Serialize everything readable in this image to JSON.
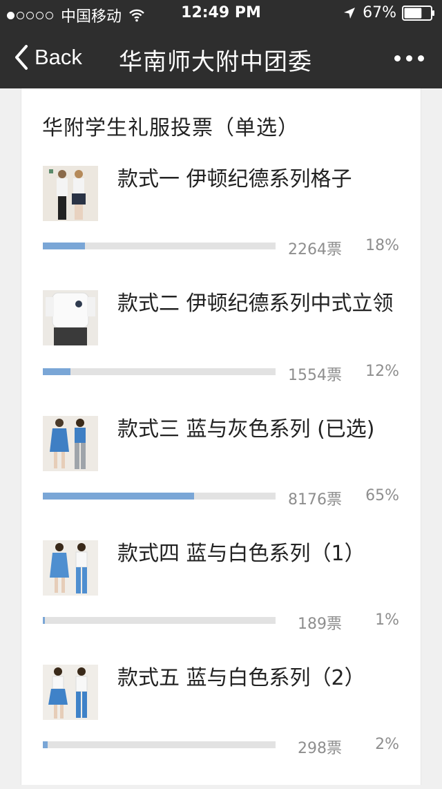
{
  "status_bar": {
    "carrier": "中国移动",
    "time": "12:49 PM",
    "battery": "67%",
    "battery_level": 0.67,
    "signal_bars_filled": 1,
    "signal_bars_total": 5
  },
  "nav": {
    "back_label": "Back",
    "title": "华南师大附中团委"
  },
  "poll": {
    "title": "华附学生礼服投票（单选）",
    "bar_color": "#7aa6d6",
    "options": [
      {
        "label": "款式一 伊顿纪德系列格子",
        "votes": "2264票",
        "percent": "18%",
        "fraction": 0.18,
        "thumb_icon": "uniform-photo-plaid"
      },
      {
        "label": "款式二 伊顿纪德系列中式立领",
        "votes": "1554票",
        "percent": "12%",
        "fraction": 0.12,
        "thumb_icon": "uniform-photo-white-shirt"
      },
      {
        "label": "款式三 蓝与灰色系列 (已选)",
        "votes": "8176票",
        "percent": "65%",
        "fraction": 0.65,
        "thumb_icon": "uniform-photo-blue-grey"
      },
      {
        "label": "款式四 蓝与白色系列（1）",
        "votes": "189票",
        "percent": "1%",
        "fraction": 0.01,
        "thumb_icon": "uniform-photo-blue-white"
      },
      {
        "label": "款式五 蓝与白色系列（2）",
        "votes": "298票",
        "percent": "2%",
        "fraction": 0.02,
        "thumb_icon": "uniform-photo-blue-white"
      }
    ]
  }
}
